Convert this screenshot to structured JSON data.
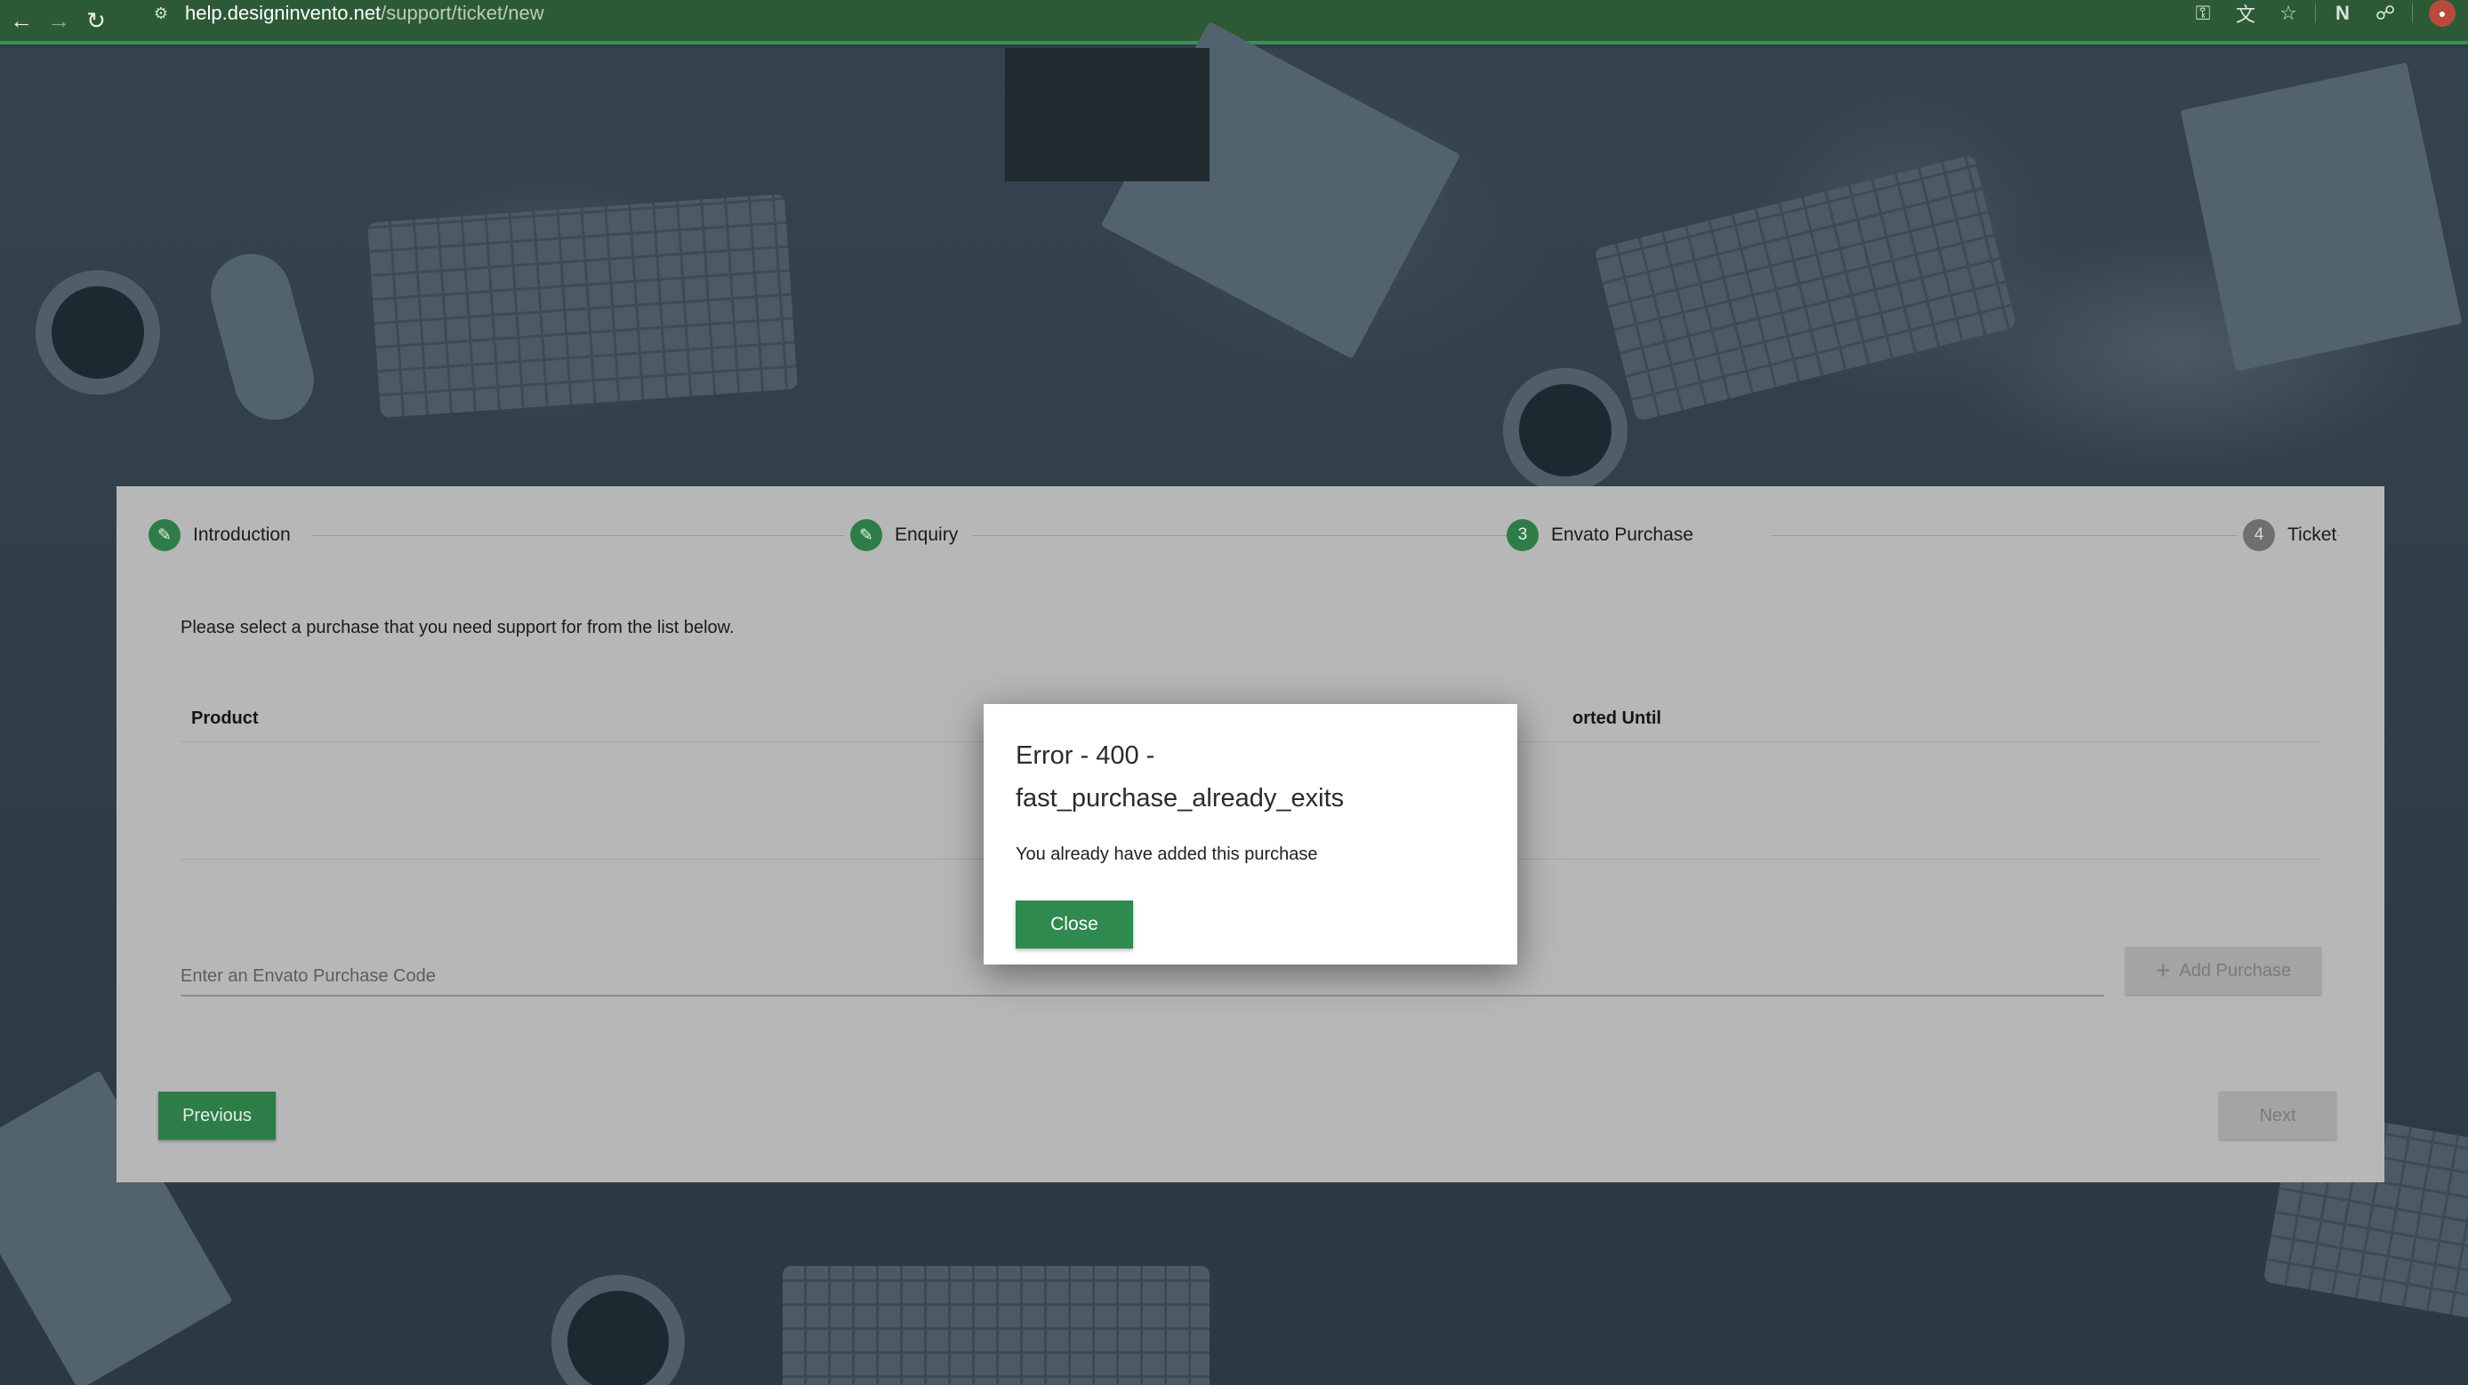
{
  "browser": {
    "url_host": "help.designinvento.net",
    "url_path": "/support/ticket/new",
    "icons": {
      "back": "back-arrow-icon",
      "forward": "forward-arrow-icon",
      "reload": "reload-icon",
      "site_info": "site-info-icon",
      "password": "key-icon",
      "translate": "translate-icon",
      "bookmark": "star-icon",
      "extension_n": "notion-icon",
      "extensions": "puzzle-icon",
      "profile": "avatar"
    },
    "theme_color": "#2d5a36"
  },
  "wizard": {
    "steps": [
      {
        "number": "",
        "label": "Introduction",
        "state": "completed",
        "icon": "pencil-icon"
      },
      {
        "number": "",
        "label": "Enquiry",
        "state": "completed",
        "icon": "pencil-icon"
      },
      {
        "number": "3",
        "label": "Envato Purchase",
        "state": "active"
      },
      {
        "number": "4",
        "label": "Ticket",
        "state": "pending"
      }
    ],
    "intro_text": "Please select a purchase that you need support for from the list below.",
    "table": {
      "columns": [
        "Product",
        "orted Until"
      ]
    },
    "purchase_code_placeholder": "Enter an Envato Purchase Code",
    "add_purchase_label": "Add Purchase",
    "previous_label": "Previous",
    "next_label": "Next",
    "accent_color": "#2e7d48"
  },
  "modal": {
    "title": "Error - 400 - fast_purchase_already_exits",
    "message": "You already have added this purchase",
    "close_label": "Close"
  }
}
